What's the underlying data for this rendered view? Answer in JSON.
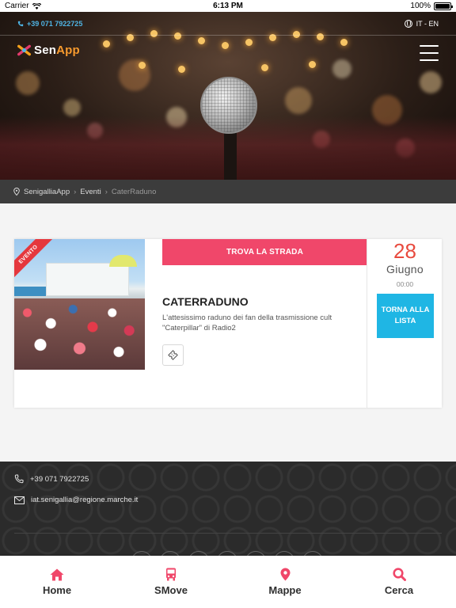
{
  "status_bar": {
    "carrier": "Carrier",
    "time": "6:13 PM",
    "battery": "100%"
  },
  "header": {
    "phone": "+39 071 7922725",
    "languages": "IT - EN",
    "logo_part1": "Sen",
    "logo_part2": "App",
    "menu_icon": "hamburger-menu-icon"
  },
  "breadcrumb": {
    "items": [
      "SenigalliaApp",
      "Eventi"
    ],
    "current": "CaterRaduno"
  },
  "event": {
    "ribbon": "EVENTO",
    "route_button": "TROVA LA STRADA",
    "title": "CATERRADUNO",
    "description": "L'attesissimo raduno dei fan della trasmissione cult \"Caterpillar\" di Radio2",
    "day": "28",
    "month": "Giugno",
    "time": "00:00",
    "back_button": "TORNA ALLA LISTA"
  },
  "footer": {
    "phone": "+39 071 7922725",
    "email": "iat.senigallia@regione.marche.it"
  },
  "bottom_nav": {
    "items": [
      {
        "label": "Home",
        "icon": "home-icon"
      },
      {
        "label": "SMove",
        "icon": "bus-icon"
      },
      {
        "label": "Mappe",
        "icon": "map-pin-icon"
      },
      {
        "label": "Cerca",
        "icon": "search-icon"
      }
    ]
  },
  "colors": {
    "accent_pink": "#f0476a",
    "accent_blue": "#1fb6e4",
    "date_red": "#e84a3e",
    "dark_bar": "#3c3c3c"
  }
}
